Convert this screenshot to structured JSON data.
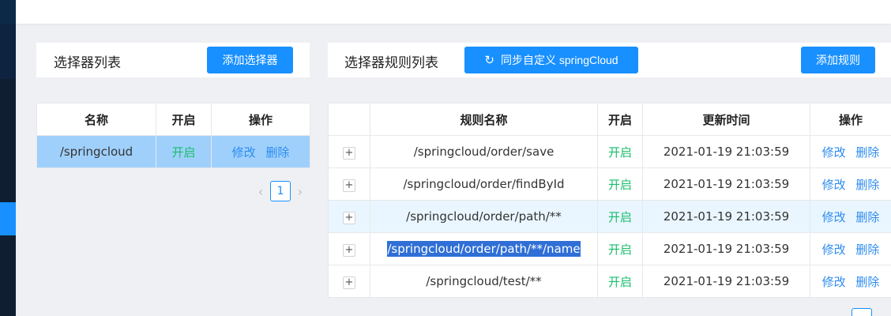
{
  "selector_panel": {
    "title": "选择器列表",
    "add_button": "添加选择器",
    "columns": [
      "名称",
      "开启",
      "操作"
    ],
    "rows": [
      {
        "name": "/springcloud",
        "status": "开启",
        "edit": "修改",
        "delete": "删除"
      }
    ],
    "pagination": {
      "prev": "‹",
      "current": "1",
      "next": "›"
    }
  },
  "rule_panel": {
    "title": "选择器规则列表",
    "sync_button": "同步自定义 springCloud",
    "sync_icon": "refresh-icon",
    "add_button": "添加规则",
    "columns": [
      "",
      "规则名称",
      "开启",
      "更新时间",
      "操作"
    ],
    "rows": [
      {
        "expand": "+",
        "name": "/springcloud/order/save",
        "status": "开启",
        "time": "2021-01-19 21:03:59",
        "edit": "修改",
        "delete": "删除"
      },
      {
        "expand": "+",
        "name": "/springcloud/order/findById",
        "status": "开启",
        "time": "2021-01-19 21:03:59",
        "edit": "修改",
        "delete": "删除"
      },
      {
        "expand": "+",
        "name": "/springcloud/order/path/**",
        "status": "开启",
        "time": "2021-01-19 21:03:59",
        "edit": "修改",
        "delete": "删除"
      },
      {
        "expand": "+",
        "name": "/springcloud/order/path/**/name",
        "status": "开启",
        "time": "2021-01-19 21:03:59",
        "edit": "修改",
        "delete": "删除"
      },
      {
        "expand": "+",
        "name": "/springcloud/test/**",
        "status": "开启",
        "time": "2021-01-19 21:03:59",
        "edit": "修改",
        "delete": "删除"
      }
    ]
  },
  "colors": {
    "primary": "#1890ff",
    "enabled_green": "#19be6b",
    "link": "#2d8cf0",
    "selected_row": "#9fd0fb"
  }
}
